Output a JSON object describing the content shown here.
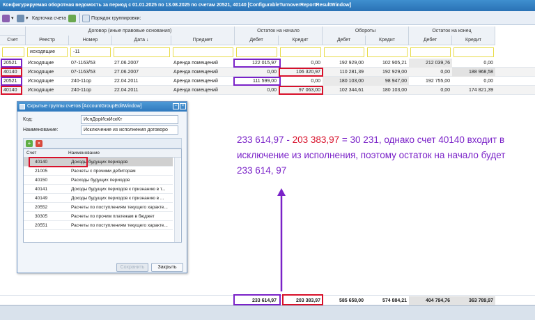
{
  "window": {
    "title": "Конфигурируемая оборотная ведомость за период с 01.01.2025 по 13.08.2025 по счетам 20521, 40140 [ConfigurableTurnoverReportResultWindow]"
  },
  "toolbar": {
    "account_card": "Карточка счета",
    "grouping_order": "Порядок группировки:"
  },
  "table": {
    "group_headers": {
      "contract": "Договор (иные правовые основания)",
      "opening": "Остаток на начало",
      "turnover": "Обороты",
      "closing": "Остаток на конец"
    },
    "columns": [
      "Счет",
      "Реестр",
      "Номер",
      "Дата ↓",
      "Предмет",
      "Дебет",
      "Кредит",
      "Дебет",
      "Кредит",
      "Дебет",
      "Кредит"
    ],
    "filters": {
      "registry": "исходящие",
      "number": "-11"
    },
    "rows": [
      [
        "20521",
        "Исходящие",
        "07-1163/53",
        "27.06.2007",
        "Аренда помещений",
        "122 015,97",
        "0,00",
        "192 929,00",
        "102 905,21",
        "212 039,76",
        "0,00"
      ],
      [
        "40140",
        "Исходящие",
        "07-1163/53",
        "27.06.2007",
        "Аренда помещений",
        "0,00",
        "106 320,97",
        "110 281,39",
        "192 929,00",
        "0,00",
        "188 968,58"
      ],
      [
        "20521",
        "Исходящие",
        "240-11ор",
        "22.04.2011",
        "Аренда помещений",
        "111 599,00",
        "0,00",
        "180 103,00",
        "98 947,00",
        "192 755,00",
        "0,00"
      ],
      [
        "40140",
        "Исходящие",
        "240-11ор",
        "22.04.2011",
        "Аренда помещений",
        "0,00",
        "97 063,00",
        "102 344,61",
        "180 103,00",
        "0,00",
        "174 821,39"
      ]
    ],
    "totals": [
      "233 614,97",
      "203 383,97",
      "585 658,00",
      "574 884,21",
      "404 794,76",
      "363 789,97"
    ]
  },
  "dialog": {
    "title": "Скрытые группы счетов [AccountGroupEditWindow]",
    "code_label": "Код:",
    "code_value": "ИспДорИскИскКт",
    "name_label": "Наименование:",
    "name_value": "Исключение из исполнения договоро",
    "grid_headers": [
      "Счет",
      "Наименование"
    ],
    "grid_rows": [
      [
        "40140",
        "Доходы будущих периодов"
      ],
      [
        "21005",
        "Расчеты с прочими дебиторам"
      ],
      [
        "40150",
        "Расходы будущих периодов"
      ],
      [
        "40141",
        "Доходы будущих периодов к признанию в т..."
      ],
      [
        "40149",
        "Доходы будущих периодов к признанию в ..."
      ],
      [
        "20552",
        "Расчеты по поступлениям текущего характе..."
      ],
      [
        "30305",
        "Расчеты по прочим платежам в бюджет"
      ],
      [
        "20551",
        "Расчеты по поступлениям текущего характе..."
      ]
    ],
    "save_button": "Сохранить",
    "close_button": "Закрыть"
  },
  "annotation": {
    "part1": "233 614,97",
    "minus": " - ",
    "part2": "203 383,97",
    "rest": " = 30 231, однако счет 40140 входит в исключение из исполнения, поэтому остаток на начало будет 233 614, 97"
  },
  "colors": {
    "annotation": "#7a22c8",
    "highlight_red": "#d8102a",
    "highlight_purple": "#7a22c8",
    "filter_border": "#e8dc4a"
  }
}
